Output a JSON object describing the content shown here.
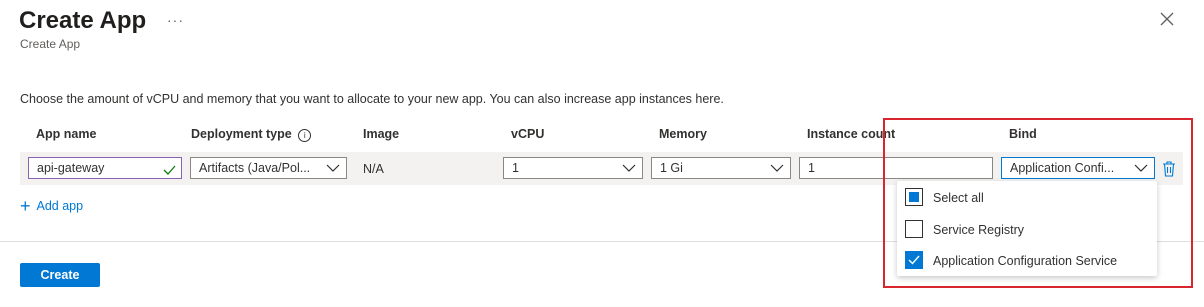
{
  "header": {
    "title": "Create App",
    "more_glyph": "···",
    "subtitle": "Create App",
    "close_icon": "close-icon"
  },
  "description": "Choose the amount of vCPU and memory that you want to allocate to your new app. You can also increase app instances here.",
  "columns": {
    "app_name": "App name",
    "deployment_type": "Deployment type",
    "image": "Image",
    "vcpu": "vCPU",
    "memory": "Memory",
    "instance_count": "Instance count",
    "bind": "Bind"
  },
  "row": {
    "app_name": "api-gateway",
    "deployment_type": "Artifacts (Java/Pol...",
    "image": "N/A",
    "vcpu": "1",
    "memory": "1 Gi",
    "instance_count": "1",
    "bind": "Application Confi..."
  },
  "add_app_label": "Add app",
  "create_label": "Create",
  "bind_dropdown": {
    "options": [
      {
        "label": "Select all",
        "state": "indeterminate"
      },
      {
        "label": "Service Registry",
        "state": "unchecked"
      },
      {
        "label": "Application Configuration Service",
        "state": "checked"
      }
    ]
  },
  "colors": {
    "accent": "#0078d4",
    "highlight": "#d9262e",
    "valid": "#107c10"
  }
}
